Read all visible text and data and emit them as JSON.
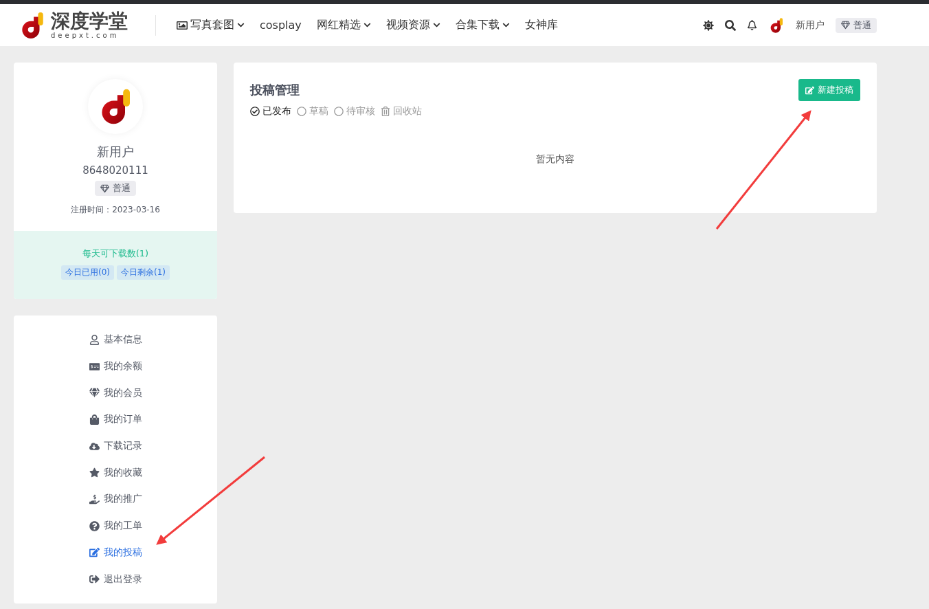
{
  "header": {
    "logo_text": "深度学堂",
    "logo_domain": "deepxt.com",
    "nav": [
      {
        "label": "写真套图",
        "dropdown": true
      },
      {
        "label": "cosplay",
        "dropdown": false
      },
      {
        "label": "网红精选",
        "dropdown": true
      },
      {
        "label": "视频资源",
        "dropdown": true
      },
      {
        "label": "合集下载",
        "dropdown": true
      },
      {
        "label": "女神库",
        "dropdown": false
      }
    ],
    "user_name": "新用户",
    "user_level": "普通"
  },
  "profile": {
    "name": "新用户",
    "id": "8648020111",
    "level": "普通",
    "registered": "注册时间：2023-03-16",
    "quota_title": "每天可下载数(1)",
    "quota_tags": [
      "今日已用(0)",
      "今日剩余(1)"
    ]
  },
  "menu": [
    {
      "label": "基本信息",
      "selected": false
    },
    {
      "label": "我的余额",
      "selected": false
    },
    {
      "label": "我的会员",
      "selected": false
    },
    {
      "label": "我的订单",
      "selected": false
    },
    {
      "label": "下载记录",
      "selected": false
    },
    {
      "label": "我的收藏",
      "selected": false
    },
    {
      "label": "我的推广",
      "selected": false
    },
    {
      "label": "我的工单",
      "selected": false
    },
    {
      "label": "我的投稿",
      "selected": true
    },
    {
      "label": "退出登录",
      "selected": false
    }
  ],
  "main": {
    "title": "投稿管理",
    "new_button": "新建投稿",
    "tabs": [
      {
        "label": "已发布",
        "selected": true,
        "kind": "status"
      },
      {
        "label": "草稿",
        "selected": false,
        "kind": "status"
      },
      {
        "label": "待审核",
        "selected": false,
        "kind": "status"
      },
      {
        "label": "回收站",
        "selected": false,
        "kind": "trash"
      }
    ],
    "empty": "暂无内容"
  }
}
